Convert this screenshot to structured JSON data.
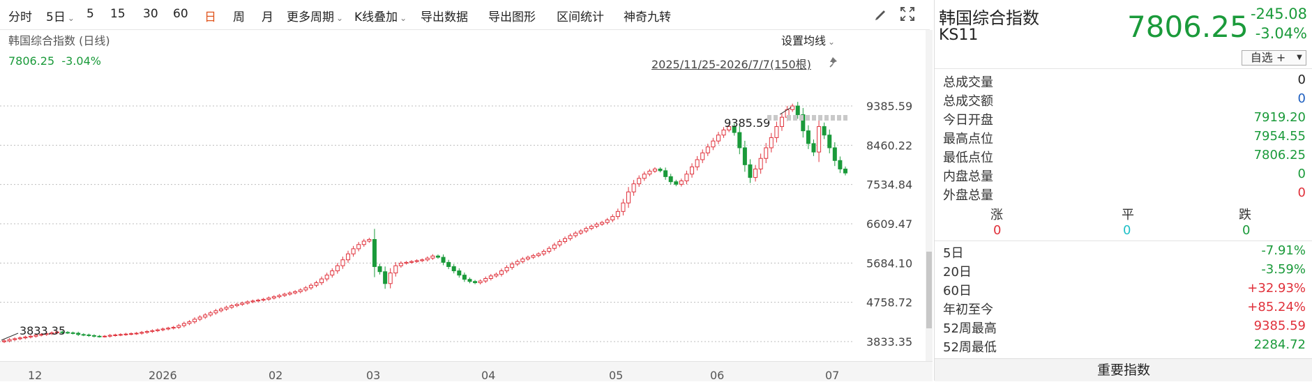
{
  "toolbar": {
    "items": [
      {
        "label": "分时",
        "dropdown": false,
        "active": false
      },
      {
        "label": "5日",
        "dropdown": true,
        "active": false
      },
      {
        "label": "5",
        "dropdown": false,
        "active": false
      },
      {
        "label": "15",
        "dropdown": false,
        "active": false
      },
      {
        "label": "30",
        "dropdown": false,
        "active": false
      },
      {
        "label": "60",
        "dropdown": false,
        "active": false
      },
      {
        "label": "日",
        "dropdown": false,
        "active": true
      },
      {
        "label": "周",
        "dropdown": false,
        "active": false
      },
      {
        "label": "月",
        "dropdown": false,
        "active": false
      },
      {
        "label": "更多周期",
        "dropdown": true,
        "active": false
      },
      {
        "label": "K线叠加",
        "dropdown": true,
        "active": false
      },
      {
        "label": "导出数据",
        "dropdown": false,
        "active": false
      },
      {
        "label": "导出图形",
        "dropdown": false,
        "active": false
      },
      {
        "label": "区间统计",
        "dropdown": false,
        "active": false
      },
      {
        "label": "神奇九转",
        "dropdown": false,
        "active": false
      }
    ],
    "icons": [
      "pencil-icon",
      "fullscreen-icon"
    ]
  },
  "chart": {
    "title": "韩国综合指数 (日线)",
    "summary_price": "7806.25",
    "summary_change": "-3.04%",
    "ma_setting_label": "设置均线",
    "date_range": "2025/11/25-2026/7/7(150根)",
    "max_annotation": "9385.59",
    "min_annotation": "3833.35",
    "colors": {
      "up": "#e0303a",
      "down": "#1a9a3a",
      "grid": "#bdbdbd"
    }
  },
  "chart_data": {
    "type": "candlestick",
    "y_ticks": [
      "9385.59",
      "8460.22",
      "7534.84",
      "6609.47",
      "5684.10",
      "4758.72",
      "3833.35"
    ],
    "y_range": [
      3833.35,
      9385.59
    ],
    "x_ticks": [
      "12",
      "2026",
      "02",
      "03",
      "04",
      "05",
      "06",
      "07"
    ],
    "close_series": [
      3850,
      3880,
      3900,
      3920,
      3940,
      3960,
      3985,
      4000,
      4020,
      4040,
      4060,
      4050,
      4040,
      4030,
      4000,
      3990,
      3975,
      3960,
      3955,
      3960,
      3980,
      3990,
      4000,
      4010,
      4020,
      4030,
      4050,
      4070,
      4090,
      4110,
      4130,
      4150,
      4170,
      4210,
      4260,
      4300,
      4360,
      4410,
      4460,
      4510,
      4560,
      4600,
      4640,
      4680,
      4710,
      4740,
      4770,
      4790,
      4810,
      4830,
      4860,
      4890,
      4920,
      4950,
      4980,
      5010,
      5050,
      5100,
      5160,
      5220,
      5310,
      5400,
      5500,
      5620,
      5760,
      5900,
      6020,
      6120,
      6200,
      6240,
      5600,
      5480,
      5200,
      5450,
      5620,
      5680,
      5700,
      5720,
      5740,
      5760,
      5800,
      5850,
      5820,
      5700,
      5600,
      5500,
      5400,
      5300,
      5250,
      5220,
      5260,
      5320,
      5380,
      5420,
      5500,
      5580,
      5660,
      5720,
      5780,
      5820,
      5860,
      5900,
      5960,
      6030,
      6110,
      6190,
      6260,
      6330,
      6390,
      6440,
      6500,
      6550,
      6600,
      6640,
      6700,
      6780,
      6900,
      7100,
      7360,
      7550,
      7680,
      7780,
      7850,
      7900,
      7860,
      7720,
      7600,
      7540,
      7620,
      7780,
      7950,
      8120,
      8280,
      8420,
      8560,
      8700,
      8820,
      8900,
      8760,
      8400,
      8000,
      7700,
      7900,
      8150,
      8400,
      8640,
      8900,
      9120,
      9300,
      9385,
      9180,
      8800,
      8500,
      8300,
      8900,
      8700,
      8400,
      8100,
      7900,
      7806
    ]
  },
  "quote": {
    "name": "韩国综合指数",
    "code": "KS11",
    "price": "7806.25",
    "change": "-245.08",
    "change_pct": "-3.04%",
    "watch_label": "自选 +",
    "rows": [
      {
        "label": "总成交量",
        "value": "0",
        "color": "black"
      },
      {
        "label": "总成交额",
        "value": "0",
        "color": "blue"
      },
      {
        "label": "今日开盘",
        "value": "7919.20",
        "color": "green"
      },
      {
        "label": "最高点位",
        "value": "7954.55",
        "color": "green"
      },
      {
        "label": "最低点位",
        "value": "7806.25",
        "color": "green"
      },
      {
        "label": "内盘总量",
        "value": "0",
        "color": "green"
      },
      {
        "label": "外盘总量",
        "value": "0",
        "color": "red"
      }
    ],
    "updown": {
      "up_label": "涨",
      "flat_label": "平",
      "down_label": "跌",
      "up": "0",
      "flat": "0",
      "down": "0"
    },
    "stats": [
      {
        "label": "5日",
        "value": "-7.91%",
        "color": "green"
      },
      {
        "label": "20日",
        "value": "-3.59%",
        "color": "green"
      },
      {
        "label": "60日",
        "value": "+32.93%",
        "color": "red"
      },
      {
        "label": "年初至今",
        "value": "+85.24%",
        "color": "red"
      },
      {
        "label": "52周最高",
        "value": "9385.59",
        "color": "red"
      },
      {
        "label": "52周最低",
        "value": "2284.72",
        "color": "green"
      }
    ],
    "bottom_button": "重要指数"
  }
}
